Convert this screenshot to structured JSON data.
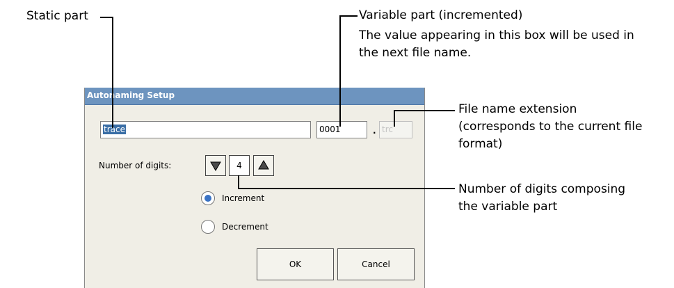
{
  "callouts": {
    "static_part": "Static part",
    "variable_part_line1": "Variable part (incremented)",
    "variable_part_line2": "The value appearing in this box will be used in",
    "variable_part_line3": "the next file name.",
    "extension_line1": "File name extension",
    "extension_line2": "(corresponds to the current file",
    "extension_line3": "format)",
    "digits_line1": "Number of digits composing",
    "digits_line2": "the variable part"
  },
  "dialog": {
    "title": "Autonaming Setup",
    "static_value": "trace",
    "variable_value": "0001",
    "dot": ".",
    "extension_value": "trc",
    "digits_label": "Number of digits:",
    "digits_value": "4",
    "radio_increment": "Increment",
    "radio_decrement": "Decrement",
    "ok_label": "OK",
    "cancel_label": "Cancel",
    "selected_option": "Increment"
  },
  "icons": {
    "spin_down": "triangle-down-icon",
    "spin_up": "triangle-up-icon"
  },
  "colors": {
    "titlebar": "#6d94bf",
    "selection": "#3a6ea5",
    "radio_checked": "#3b73c4"
  }
}
